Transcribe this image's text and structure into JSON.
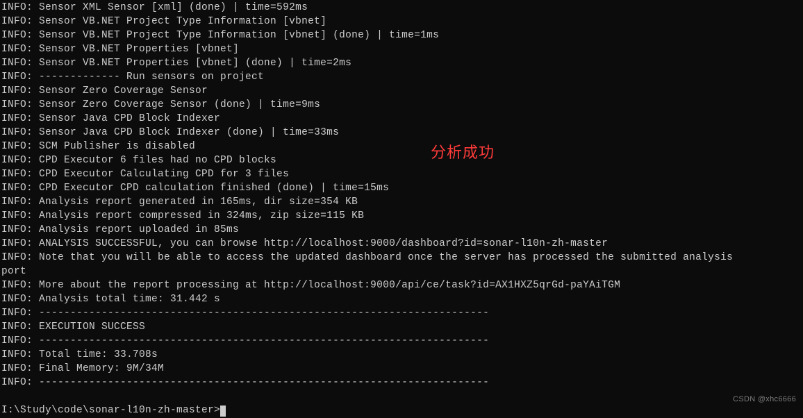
{
  "lines": [
    "INFO: Sensor XML Sensor [xml] (done) | time=592ms",
    "INFO: Sensor VB.NET Project Type Information [vbnet]",
    "INFO: Sensor VB.NET Project Type Information [vbnet] (done) | time=1ms",
    "INFO: Sensor VB.NET Properties [vbnet]",
    "INFO: Sensor VB.NET Properties [vbnet] (done) | time=2ms",
    "INFO: ------------- Run sensors on project",
    "INFO: Sensor Zero Coverage Sensor",
    "INFO: Sensor Zero Coverage Sensor (done) | time=9ms",
    "INFO: Sensor Java CPD Block Indexer",
    "INFO: Sensor Java CPD Block Indexer (done) | time=33ms",
    "INFO: SCM Publisher is disabled",
    "INFO: CPD Executor 6 files had no CPD blocks",
    "INFO: CPD Executor Calculating CPD for 3 files",
    "INFO: CPD Executor CPD calculation finished (done) | time=15ms",
    "INFO: Analysis report generated in 165ms, dir size=354 KB",
    "INFO: Analysis report compressed in 324ms, zip size=115 KB",
    "INFO: Analysis report uploaded in 85ms",
    "INFO: ANALYSIS SUCCESSFUL, you can browse http://localhost:9000/dashboard?id=sonar-l10n-zh-master",
    "INFO: Note that you will be able to access the updated dashboard once the server has processed the submitted analysis",
    "port",
    "INFO: More about the report processing at http://localhost:9000/api/ce/task?id=AX1HXZ5qrGd-paYAiTGM",
    "INFO: Analysis total time: 31.442 s",
    "INFO: ------------------------------------------------------------------------",
    "INFO: EXECUTION SUCCESS",
    "INFO: ------------------------------------------------------------------------",
    "INFO: Total time: 33.708s",
    "INFO: Final Memory: 9M/34M",
    "INFO: ------------------------------------------------------------------------"
  ],
  "prompt": "I:\\Study\\code\\sonar-l10n-zh-master>",
  "annotation": "分析成功",
  "watermark": "CSDN @xhc6666"
}
